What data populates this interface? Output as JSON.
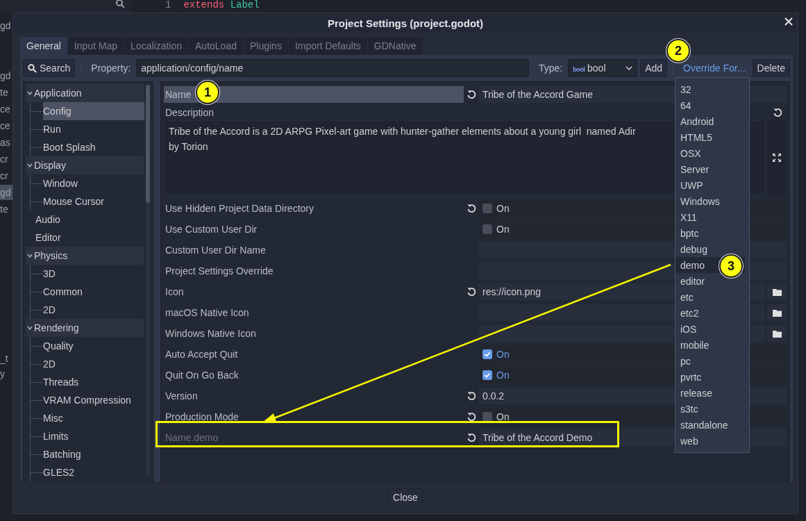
{
  "background": {
    "code_line_number": "1",
    "code_keyword": "extends",
    "code_type": "Label",
    "file_fragments": [
      {
        "text": "gd",
        "selected": false
      },
      {
        "text": "gd",
        "selected": false
      },
      {
        "text": "te",
        "selected": false
      },
      {
        "text": "ce",
        "selected": false
      },
      {
        "text": "ce",
        "selected": false
      },
      {
        "text": "as",
        "selected": false
      },
      {
        "text": "cr",
        "selected": false
      },
      {
        "text": "cr",
        "selected": false
      },
      {
        "text": "gd",
        "selected": true
      },
      {
        "text": "te",
        "selected": false
      },
      {
        "text": "_t",
        "selected": false
      },
      {
        "text": "y",
        "selected": false
      }
    ]
  },
  "window": {
    "title": "Project Settings (project.godot)"
  },
  "tabs": [
    {
      "label": "General",
      "selected": true
    },
    {
      "label": "Input Map",
      "selected": false
    },
    {
      "label": "Localization",
      "selected": false
    },
    {
      "label": "AutoLoad",
      "selected": false
    },
    {
      "label": "Plugins",
      "selected": false
    },
    {
      "label": "Import Defaults",
      "selected": false
    },
    {
      "label": "GDNative",
      "selected": false
    }
  ],
  "toolbar": {
    "search_button": "Search",
    "property_label": "Property:",
    "property_value": "application/config/name",
    "type_label": "Type:",
    "type_icon_text": "bool",
    "type_value": "bool",
    "add_button": "Add",
    "override_button": "Override For...",
    "delete_button": "Delete"
  },
  "sidebar": {
    "items": [
      {
        "label": "Application",
        "expanded": true,
        "selected": false,
        "children": [
          {
            "label": "Config",
            "selected": true
          },
          {
            "label": "Run",
            "selected": false
          },
          {
            "label": "Boot Splash",
            "selected": false
          }
        ]
      },
      {
        "label": "Display",
        "expanded": true,
        "selected": false,
        "children": [
          {
            "label": "Window",
            "selected": false
          },
          {
            "label": "Mouse Cursor",
            "selected": false
          }
        ]
      },
      {
        "label": "Audio",
        "selected": false
      },
      {
        "label": "Editor",
        "selected": false
      },
      {
        "label": "Physics",
        "expanded": true,
        "selected": false,
        "children": [
          {
            "label": "3D",
            "selected": false
          },
          {
            "label": "Common",
            "selected": false
          },
          {
            "label": "2D",
            "selected": false
          }
        ]
      },
      {
        "label": "Rendering",
        "expanded": true,
        "selected": false,
        "children": [
          {
            "label": "Quality",
            "selected": false
          },
          {
            "label": "2D",
            "selected": false
          },
          {
            "label": "Threads",
            "selected": false
          },
          {
            "label": "VRAM Compression",
            "selected": false
          },
          {
            "label": "Misc",
            "selected": false
          },
          {
            "label": "Limits",
            "selected": false
          },
          {
            "label": "Batching",
            "selected": false
          },
          {
            "label": "GLES2",
            "selected": false
          }
        ]
      }
    ]
  },
  "properties": [
    {
      "kind": "text",
      "label": "Name",
      "selected": true,
      "revert": true,
      "value": "Tribe of the Accord Game"
    },
    {
      "kind": "textarea",
      "label": "Description",
      "revert": true,
      "value_lines": [
        "Tribe of the Accord is a 2D ARPG Pixel-art game with hunter-gather elements about a young girl  named Adir",
        "by Torion"
      ]
    },
    {
      "kind": "checkbox",
      "label": "Use Hidden Project Data Directory",
      "selected": false,
      "revert": true,
      "checked": false,
      "value": "On"
    },
    {
      "kind": "checkbox",
      "label": "Use Custom User Dir",
      "selected": false,
      "revert": false,
      "checked": false,
      "value": "On"
    },
    {
      "kind": "text",
      "label": "Custom User Dir Name",
      "selected": false,
      "revert": false
    },
    {
      "kind": "text",
      "label": "Project Settings Override",
      "selected": false,
      "revert": false
    },
    {
      "kind": "file",
      "label": "Icon",
      "selected": false,
      "revert": true,
      "value": "res://icon.png"
    },
    {
      "kind": "file",
      "label": "macOS Native Icon",
      "selected": false,
      "revert": false
    },
    {
      "kind": "file",
      "label": "Windows Native Icon",
      "selected": false,
      "revert": false
    },
    {
      "kind": "checkbox",
      "label": "Auto Accept Quit",
      "selected": false,
      "revert": false,
      "checked": true,
      "value": "On"
    },
    {
      "kind": "checkbox",
      "label": "Quit On Go Back",
      "selected": false,
      "revert": false,
      "checked": true,
      "value": "On"
    },
    {
      "kind": "text",
      "label": "Version",
      "selected": false,
      "revert": true,
      "value": "0.0.2"
    },
    {
      "kind": "checkbox",
      "label": "Production Mode",
      "selected": false,
      "revert": true,
      "checked": false,
      "value": "On"
    },
    {
      "kind": "text",
      "label": "Name.demo",
      "selected": false,
      "revert": true,
      "overridden": true,
      "highlighted": true,
      "value": "Tribe of the Accord Demo"
    }
  ],
  "override_menu": {
    "items": [
      {
        "label": "32",
        "selected": false
      },
      {
        "label": "64",
        "selected": false
      },
      {
        "label": "Android",
        "selected": false
      },
      {
        "label": "HTML5",
        "selected": false
      },
      {
        "label": "OSX",
        "selected": false
      },
      {
        "label": "Server",
        "selected": false
      },
      {
        "label": "UWP",
        "selected": false
      },
      {
        "label": "Windows",
        "selected": false
      },
      {
        "label": "X11",
        "selected": false
      },
      {
        "label": "bptc",
        "selected": false
      },
      {
        "label": "debug",
        "selected": false
      },
      {
        "label": "demo",
        "selected": true
      },
      {
        "label": "editor",
        "selected": false
      },
      {
        "label": "etc",
        "selected": false
      },
      {
        "label": "etc2",
        "selected": false
      },
      {
        "label": "iOS",
        "selected": false
      },
      {
        "label": "mobile",
        "selected": false
      },
      {
        "label": "pc",
        "selected": false
      },
      {
        "label": "pvrtc",
        "selected": false
      },
      {
        "label": "release",
        "selected": false
      },
      {
        "label": "s3tc",
        "selected": false
      },
      {
        "label": "standalone",
        "selected": false
      },
      {
        "label": "web",
        "selected": false
      }
    ]
  },
  "annotations": [
    {
      "number": "1"
    },
    {
      "number": "2"
    },
    {
      "number": "3"
    }
  ],
  "close_button": "Close"
}
